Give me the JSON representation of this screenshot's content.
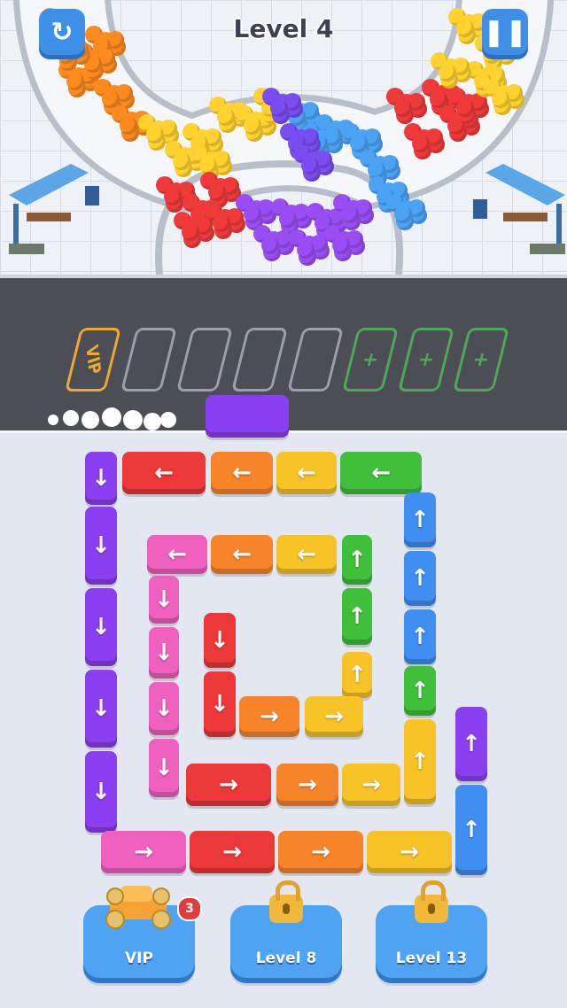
{
  "header": {
    "level_title": "Level 4",
    "restart_icon": "restart-icon",
    "pause_icon": "pause-icon"
  },
  "parking": {
    "vip_label": "VIP",
    "empty_slots": 4,
    "unlockable_slots": 3,
    "plus_symbol": "+"
  },
  "buses": [
    {
      "color": "purple",
      "dir": "left"
    },
    {
      "color": "red",
      "dir": "left"
    },
    {
      "color": "orange",
      "dir": "left"
    },
    {
      "color": "yellow",
      "dir": "left"
    },
    {
      "color": "green",
      "dir": "left"
    },
    {
      "color": "purple",
      "dir": "down"
    },
    {
      "color": "purple",
      "dir": "down"
    },
    {
      "color": "purple",
      "dir": "down"
    },
    {
      "color": "purple",
      "dir": "down"
    },
    {
      "color": "purple",
      "dir": "down"
    },
    {
      "color": "pink",
      "dir": "left"
    },
    {
      "color": "orange",
      "dir": "left"
    },
    {
      "color": "yellow",
      "dir": "left"
    },
    {
      "color": "green",
      "dir": "up"
    },
    {
      "color": "green",
      "dir": "up"
    },
    {
      "color": "pink",
      "dir": "down"
    },
    {
      "color": "pink",
      "dir": "down"
    },
    {
      "color": "pink",
      "dir": "down"
    },
    {
      "color": "pink",
      "dir": "down"
    },
    {
      "color": "red",
      "dir": "down"
    },
    {
      "color": "red",
      "dir": "down"
    },
    {
      "color": "yellow",
      "dir": "up"
    },
    {
      "color": "orange",
      "dir": "right"
    },
    {
      "color": "yellow",
      "dir": "right"
    },
    {
      "color": "blue",
      "dir": "up"
    },
    {
      "color": "blue",
      "dir": "up"
    },
    {
      "color": "blue",
      "dir": "up"
    },
    {
      "color": "green",
      "dir": "up"
    },
    {
      "color": "yellow",
      "dir": "up"
    },
    {
      "color": "purple",
      "dir": "up"
    },
    {
      "color": "blue",
      "dir": "up"
    },
    {
      "color": "red",
      "dir": "right"
    },
    {
      "color": "orange",
      "dir": "right"
    },
    {
      "color": "yellow",
      "dir": "right"
    },
    {
      "color": "pink",
      "dir": "right"
    },
    {
      "color": "red",
      "dir": "right"
    },
    {
      "color": "orange",
      "dir": "right"
    },
    {
      "color": "yellow",
      "dir": "right"
    }
  ],
  "colors": {
    "purple": "#8c3ff0",
    "red": "#ec3838",
    "orange": "#f8842a",
    "yellow": "#f7c327",
    "green": "#3fbf3a",
    "blue": "#3f8ef2",
    "pink": "#f060be",
    "crowd_orange": "#fb8a1f",
    "crowd_yellow": "#ffd230",
    "crowd_red": "#f03a3a",
    "crowd_purple": "#9a4df5",
    "crowd_blue": "#4aa3f5",
    "crowd_violet": "#7a4df2"
  },
  "footer": {
    "vip": {
      "label": "VIP",
      "count": "3",
      "icon": "vip-car-icon"
    },
    "level8": {
      "label": "Level 8",
      "icon": "lock-icon"
    },
    "level13": {
      "label": "Level 13",
      "icon": "lock-icon"
    }
  }
}
